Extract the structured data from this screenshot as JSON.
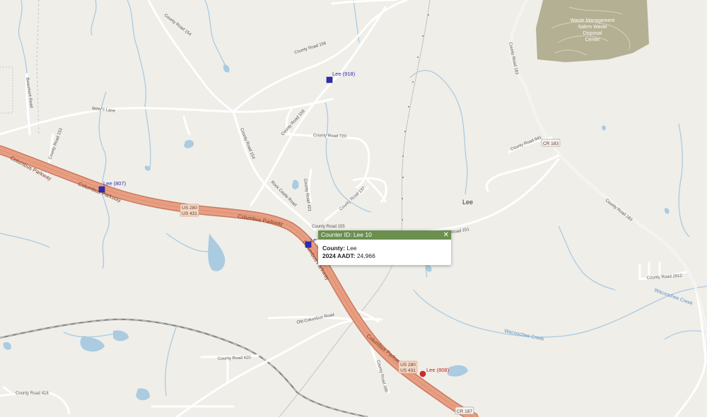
{
  "colors": {
    "land": "#f0eee9",
    "water": "#aacbe0",
    "highway_fill": "#e89e82",
    "highway_casing": "#c97a5e",
    "landfill": "#b3b094",
    "counter_blue": "#2d2db0",
    "counter_red": "#d42a2a",
    "popup_header": "#6b8f4f"
  },
  "places": {
    "lee": "Lee",
    "waste_facility": [
      "Waste Management",
      "Salem Waste",
      "Disposal",
      "Center"
    ]
  },
  "highways": {
    "columbus_parkway": "Columbus Parkway",
    "us280": "US 280",
    "us431": "US 431",
    "cr183": "CR 183",
    "cr187": "CR 187"
  },
  "roads": {
    "cr154": "County Road 154",
    "cr156": "County Road 156",
    "cr158": "County Road 158",
    "cr720": "County Road 720",
    "cr153": "County Road 153",
    "cr155": "County Road 155",
    "cr183": "County Road 183",
    "cr941": "County Road 941",
    "cr2012": "County Road 2012",
    "cr151": "County Road 151",
    "cr137": "County Road 137",
    "cr421": "County Road 421",
    "cr420": "County Road 420",
    "cr186": "County Road 186",
    "cr418": "County Road 418",
    "bettys_lane": "Betty's Lane",
    "rock_castle": "Rock Castle Road",
    "old_columbus": "Old Columbus Road",
    "beaumont": "Beaumont Road"
  },
  "water": {
    "wacoochee_creek": "Wacoochee Creek"
  },
  "counters": {
    "lee918": "Lee (918)",
    "lee807": "Lee (807)",
    "lee10": "Lee",
    "lee808": "Lee (808)"
  },
  "popup": {
    "title": "Counter ID: Lee 10",
    "close_glyph": "✕",
    "county_label": "County:",
    "county_value": "Lee",
    "aadt_label": "2024 AADT:",
    "aadt_value": "24,966"
  }
}
